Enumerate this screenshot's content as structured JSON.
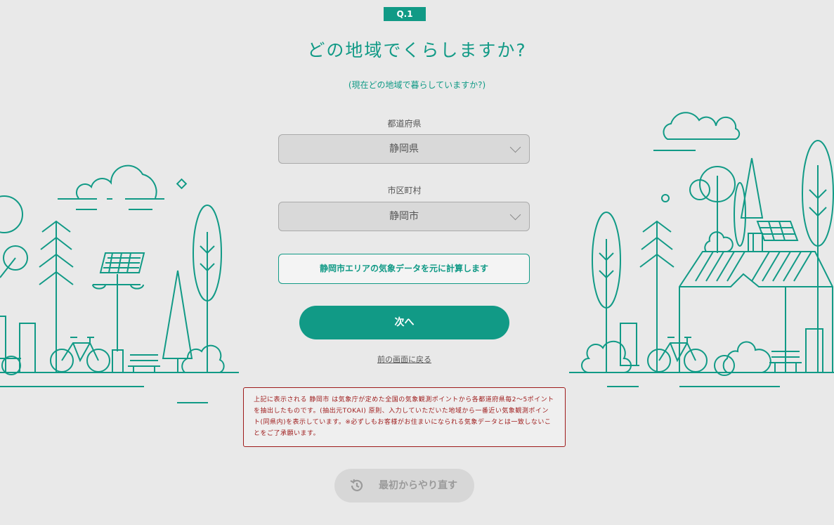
{
  "question": {
    "badge": "Q.1",
    "title": "どの地域でくらしますか?",
    "subtitle": "(現在どの地域で暮らしていますか?)"
  },
  "prefecture": {
    "label": "都道府県",
    "selected": "静岡県"
  },
  "city": {
    "label": "市区町村",
    "selected": "静岡市"
  },
  "calc_note": "静岡市エリアの気象データを元に計算します",
  "next_label": "次へ",
  "back_label": "前の画面に戻る",
  "notice": "上記に表示される 静岡市 は気象庁が定めた全国の気象観測ポイントから各都道府県毎2〜5ポイントを抽出したものです。(抽出元TOKAI) 原則、入力していただいた地域から一番近い気象観測ポイント(同県内)を表示しています。※必ずしもお客様がお住まいになられる気象データとは一致しないことをご了承願います。",
  "restart_label": "最初からやり直す",
  "colors": {
    "accent": "#119a86",
    "warning": "#9e1a1a",
    "background": "#e9e9e9"
  },
  "icons": {
    "restart": "history-icon",
    "dropdown": "chevron-down-icon"
  }
}
